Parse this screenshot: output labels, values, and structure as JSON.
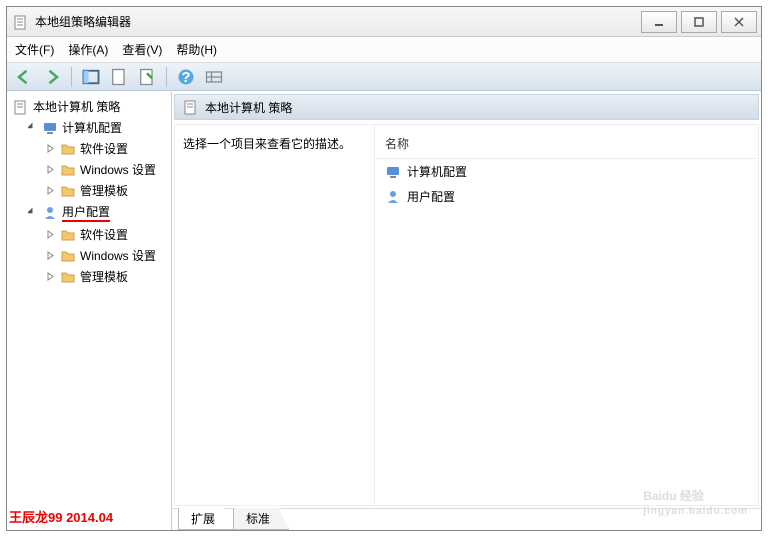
{
  "window": {
    "title": "本地组策略编辑器"
  },
  "menu": {
    "file": "文件(F)",
    "action": "操作(A)",
    "view": "查看(V)",
    "help": "帮助(H)"
  },
  "tree": {
    "root": "本地计算机 策略",
    "computer_config": "计算机配置",
    "software_settings": "软件设置",
    "windows_settings": "Windows 设置",
    "admin_templates": "管理模板",
    "user_config": "用户配置"
  },
  "detail": {
    "header": "本地计算机 策略",
    "description": "选择一个项目来查看它的描述。",
    "column_name": "名称",
    "items": {
      "computer_config": "计算机配置",
      "user_config": "用户配置"
    }
  },
  "tabs": {
    "extended": "扩展",
    "standard": "标准"
  },
  "watermark": "王辰龙99 2014.04",
  "baidu": {
    "brand": "Baidu 经验",
    "url": "jingyan.baidu.com"
  }
}
